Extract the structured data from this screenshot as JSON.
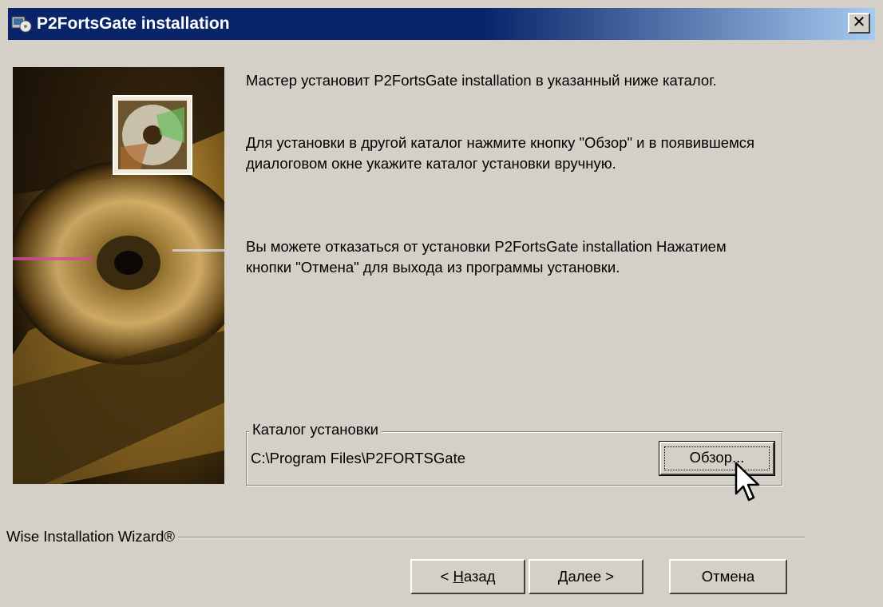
{
  "window": {
    "title": "P2FortsGate installation",
    "close_label": "✕"
  },
  "content": {
    "para1": "Мастер установит P2FortsGate installation в указанный ниже каталог.",
    "para2": "Для установки в другой каталог нажмите кнопку \"Обзор\" и в появившемся диалоговом окне укажите каталог установки вручную.",
    "para3": "Вы можете отказаться от установки P2FortsGate installation Нажатием кнопки \"Отмена\" для выхода из программы установки."
  },
  "install_dir": {
    "label": "Каталог установки",
    "path": "C:\\Program Files\\P2FORTSGate",
    "browse_label": "Обзор..."
  },
  "footer": {
    "wizard_label": "Wise Installation Wizard®",
    "back_prefix": "< ",
    "back_mnemonic": "Н",
    "back_rest": "азад",
    "next_mnemonic": "Д",
    "next_rest": "алее >",
    "cancel_label": "Отмена"
  },
  "colors": {
    "titlebar": "#0a246a",
    "dialog_bg": "#d4d0c8"
  }
}
